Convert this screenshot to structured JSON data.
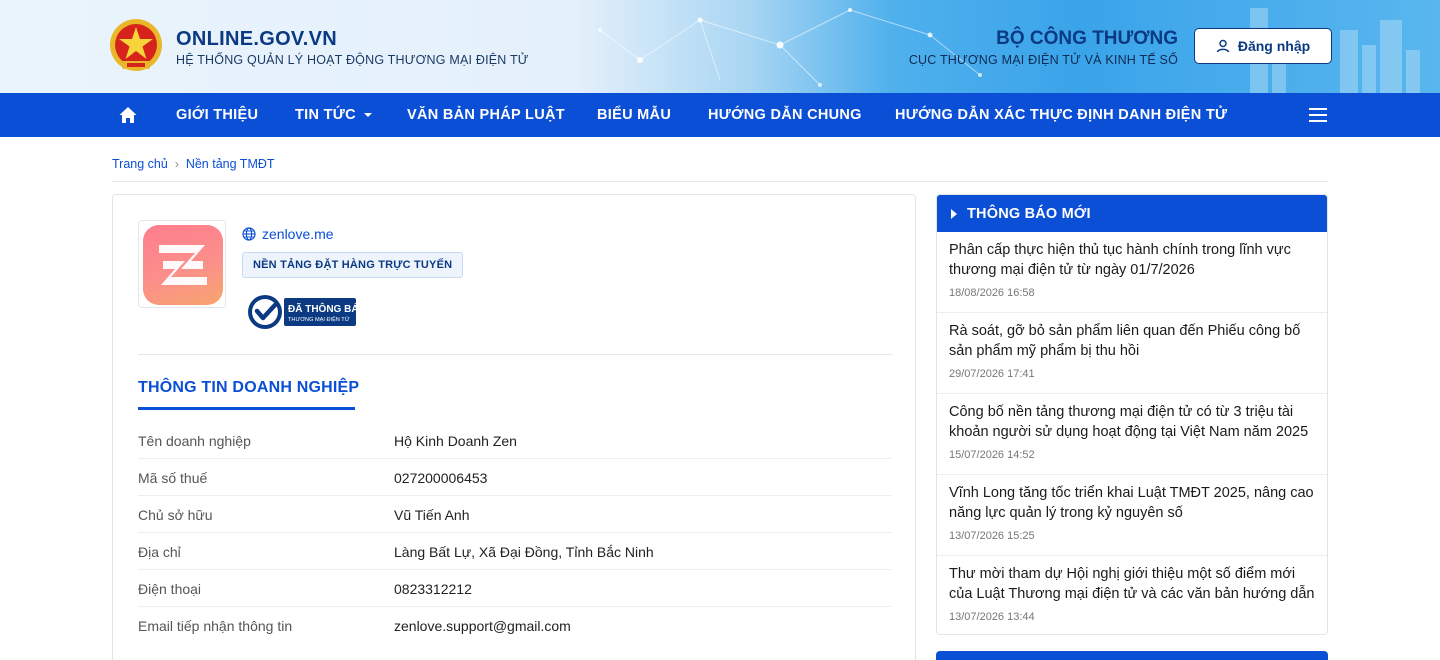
{
  "header": {
    "brand_title": "ONLINE.GOV.VN",
    "brand_subtitle": "HỆ THỐNG QUẢN LÝ HOẠT ĐỘNG THƯƠNG MẠI ĐIỆN TỬ",
    "ministry": "BỘ CÔNG THƯƠNG",
    "department": "CỤC THƯƠNG MẠI ĐIỆN TỬ VÀ KINH TẾ SỐ",
    "login_label": "Đăng nhập"
  },
  "nav": {
    "items": [
      "GIỚI THIỆU",
      "TIN TỨC",
      "VĂN BẢN PHÁP LUẬT",
      "BIỂU MẪU",
      "HƯỚNG DẪN CHUNG",
      "HƯỚNG DẪN XÁC THỰC ĐỊNH DANH ĐIỆN TỬ"
    ]
  },
  "breadcrumb": {
    "home": "Trang chủ",
    "current": "Nền tảng TMĐT"
  },
  "platform": {
    "website": "zenlove.me",
    "type_tag": "NỀN TẢNG ĐẶT HÀNG TRỰC TUYẾN",
    "badge_text": "ĐÃ THÔNG BÁO",
    "badge_sub": "THƯƠNG MẠI ĐIỆN TỬ"
  },
  "business_info": {
    "section_title": "THÔNG TIN DOANH NGHIỆP",
    "rows": [
      {
        "label": "Tên doanh nghiệp",
        "value": "Hộ Kinh Doanh Zen"
      },
      {
        "label": "Mã số thuế",
        "value": "027200006453"
      },
      {
        "label": "Chủ sở hữu",
        "value": "Vũ Tiến Anh"
      },
      {
        "label": "Địa chỉ",
        "value": "Làng Bất Lự, Xã Đại Đồng, Tỉnh Bắc Ninh"
      },
      {
        "label": "Điện thoại",
        "value": "0823312212"
      },
      {
        "label": "Email tiếp nhận thông tin",
        "value": "zenlove.support@gmail.com"
      }
    ]
  },
  "sidebar": {
    "title": "THÔNG BÁO MỚI",
    "news": [
      {
        "title": "Phân cấp thực hiện thủ tục hành chính trong lĩnh vực thương mại điện tử từ ngày 01/7/2026",
        "date": "18/08/2026 16:58"
      },
      {
        "title": "Rà soát, gỡ bỏ sản phẩm liên quan đến Phiếu công bố sản phẩm mỹ phẩm bị thu hồi",
        "date": "29/07/2026 17:41"
      },
      {
        "title": "Công bố nền tảng thương mại điện tử có từ 3 triệu tài khoản người sử dụng hoạt động tại Việt Nam năm 2025",
        "date": "15/07/2026 14:52"
      },
      {
        "title": "Vĩnh Long tăng tốc triển khai Luật TMĐT 2025, nâng cao năng lực quản lý trong kỷ nguyên số",
        "date": "13/07/2026 15:25"
      },
      {
        "title": "Thư mời tham dự Hội nghị giới thiệu một số điểm mới của Luật Thương mại điện tử và các văn bản hướng dẫn",
        "date": "13/07/2026 13:44"
      }
    ]
  },
  "colors": {
    "primary": "#0a4fd6",
    "brand_navy": "#0b3a82",
    "app_gradient_start": "#ff7d8e",
    "app_gradient_end": "#f7a56f"
  },
  "icons": [
    "national-emblem-icon",
    "user-icon",
    "home-icon",
    "caret-down-icon",
    "hamburger-menu-icon",
    "globe-icon",
    "app-logo-icon",
    "verified-check-icon",
    "triangle-right-icon"
  ]
}
